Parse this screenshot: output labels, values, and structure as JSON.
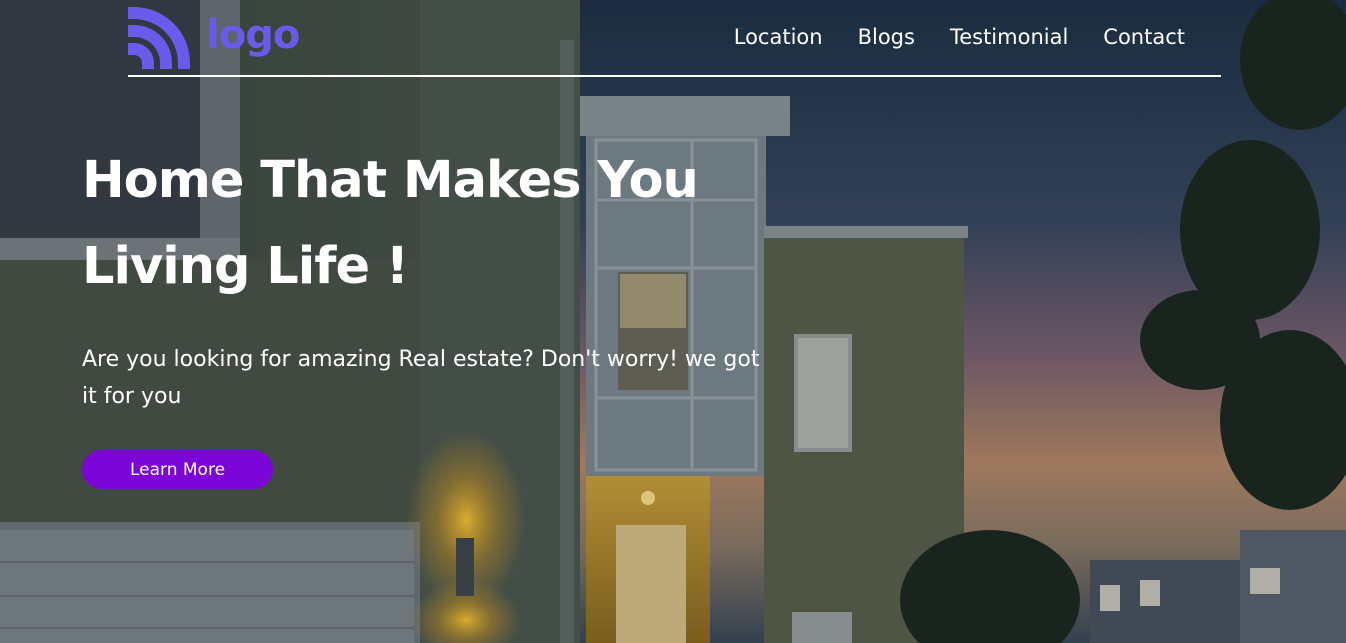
{
  "brand": {
    "logo_text": "logo",
    "logo_icon": "wifi-arcs-icon",
    "logo_color": "#6b5bec"
  },
  "nav": {
    "items": [
      {
        "label": "Location"
      },
      {
        "label": "Blogs"
      },
      {
        "label": "Testimonial"
      },
      {
        "label": "Contact"
      }
    ]
  },
  "hero": {
    "headline": "Home That Makes You Living Life !",
    "subtext": "Are you looking for amazing Real estate? Don't worry! we got it for you",
    "cta_label": "Learn More",
    "cta_color": "#7c05d8",
    "background": "house-at-dusk-photo"
  }
}
